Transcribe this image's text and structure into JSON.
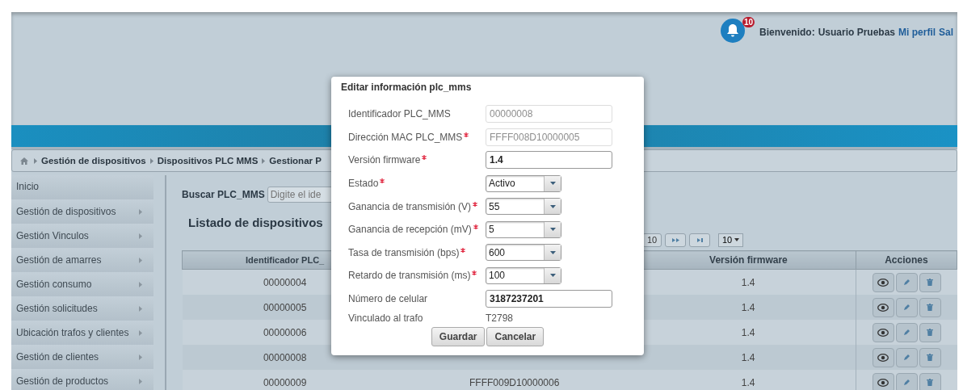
{
  "header": {
    "notifications": {
      "count": "10"
    },
    "welcome": {
      "label": "Bienvenido:",
      "user": "Usuario Pruebas",
      "links": [
        "Mi perfil",
        "Sal"
      ]
    }
  },
  "breadcrumb": [
    "Gestión de dispositivos",
    "Dispositivos PLC  MMS",
    "Gestionar P"
  ],
  "sidebar": {
    "items": [
      {
        "label": "Inicio",
        "has_submenu": false
      },
      {
        "label": "Gestión de dispositivos",
        "has_submenu": true
      },
      {
        "label": "Gestión Vinculos",
        "has_submenu": true
      },
      {
        "label": "Gestión de amarres",
        "has_submenu": true
      },
      {
        "label": "Gestión consumo",
        "has_submenu": true
      },
      {
        "label": "Gestión solicitudes",
        "has_submenu": true
      },
      {
        "label": "Ubicación trafos y clientes",
        "has_submenu": true
      },
      {
        "label": "Gestión de clientes",
        "has_submenu": true
      },
      {
        "label": "Gestión de productos",
        "has_submenu": true
      }
    ]
  },
  "search": {
    "label": "Buscar PLC_MMS",
    "placeholder": "Digite el ide"
  },
  "list_title": "Listado de dispositivos",
  "pagination": {
    "page": "10",
    "page_size": "10"
  },
  "table": {
    "columns": [
      "Identificador PLC_",
      "",
      "Versión firmware",
      "Acciones"
    ],
    "rows": [
      {
        "id": "00000004",
        "mac": "",
        "version": "1.4"
      },
      {
        "id": "00000005",
        "mac": "",
        "version": "1.4"
      },
      {
        "id": "00000006",
        "mac": "",
        "version": "1.4"
      },
      {
        "id": "00000008",
        "mac": "",
        "version": "1.4"
      },
      {
        "id": "00000009",
        "mac": "FFFF009D10000006",
        "version": "1.4"
      }
    ]
  },
  "dialog": {
    "title": "Editar información plc_mms",
    "fields": [
      {
        "kind": "text",
        "label": "Identificador PLC_MMS",
        "required": false,
        "value": "00000008",
        "disabled": true
      },
      {
        "kind": "text",
        "label": "Dirección MAC PLC_MMS",
        "required": true,
        "value": "FFFF008D10000005",
        "disabled": true
      },
      {
        "kind": "text",
        "label": "Versión firmware",
        "required": true,
        "value": "1.4",
        "disabled": false
      },
      {
        "kind": "select",
        "label": "Estado",
        "required": true,
        "value": "Activo"
      },
      {
        "kind": "select",
        "label": "Ganancia de transmisión (V)",
        "required": true,
        "value": "55"
      },
      {
        "kind": "select",
        "label": "Ganancia de recepción (mV)",
        "required": true,
        "value": "5"
      },
      {
        "kind": "select",
        "label": "Tasa de transmisión (bps)",
        "required": true,
        "value": "600"
      },
      {
        "kind": "select",
        "label": "Retardo de transmisión (ms)",
        "required": true,
        "value": "100"
      },
      {
        "kind": "text",
        "label": "Número de celular",
        "required": false,
        "value": "3187237201",
        "disabled": false
      },
      {
        "kind": "static",
        "label": "Vinculado al trafo",
        "required": false,
        "value": "T2798"
      }
    ],
    "buttons": [
      "Guardar",
      "Cancelar"
    ]
  }
}
